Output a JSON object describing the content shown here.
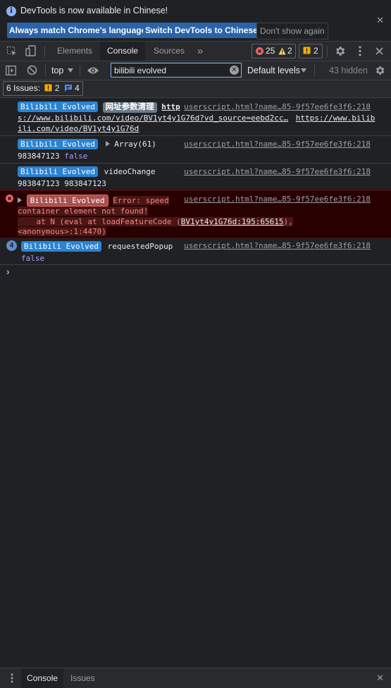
{
  "infobar": {
    "message": "DevTools is now available in Chinese!",
    "btn_match": "Always match Chrome's language",
    "btn_switch": "Switch DevTools to Chinese",
    "btn_dismiss": "Don't show again",
    "close": "✕"
  },
  "tabs": {
    "elements": "Elements",
    "console": "Console",
    "sources": "Sources",
    "more": "»"
  },
  "counts": {
    "errors": "25",
    "warnings": "2",
    "issues": "2"
  },
  "filter": {
    "context": "top",
    "search_value": "bilibili evolved",
    "levels": "Default levels",
    "hidden": "43 hidden"
  },
  "issues_bar": {
    "label": "6 Issues:",
    "warn_count": "2",
    "info_count": "4"
  },
  "messages": [
    {
      "badge": "Bilibili Evolved",
      "badge2": "网址参数清理",
      "text_a": "http",
      "text_b": "s://www.bilibili.com/video/BV1yt4y1G76d?vd_source=eebd2cc…",
      "text_c": "https://www.bilib",
      "text_d": "ili.com/video/BV1yt4y1G76d",
      "source": "userscript.html?name…85-9f57ee6fe3f6:218"
    },
    {
      "badge": "Bilibili Evolved",
      "text_a": "Array(61)",
      "num": "983847123",
      "kw": "false",
      "source": "userscript.html?name…85-9f57ee6fe3f6:218"
    },
    {
      "badge": "Bilibili Evolved",
      "text_a": "videoChange",
      "line2": "983847123 983847123",
      "source": "userscript.html?name…85-9f57ee6fe3f6:218"
    },
    {
      "badge": "Bilibili Evolved",
      "err_a": "Error: speed",
      "err_b": "container element not found!",
      "err_c_pre": "    at N (eval at loadFeatureCode (",
      "err_c_link": "BV1yt4y1G76d:195:65615",
      "err_c_post": "),",
      "err_d": "<anonymous>:1:4470)",
      "source": "userscript.html?name…85-9f57ee6fe3f6:218"
    },
    {
      "count": "4",
      "badge": "Bilibili Evolved",
      "text_a": "requestedPopup",
      "kw": "false",
      "source": "userscript.html?name…85-9f57ee6fe3f6:218"
    }
  ],
  "prompt": "›",
  "drawer": {
    "console": "Console",
    "issues": "Issues",
    "close": "✕"
  },
  "colors": {
    "accent": "#8ab4f8",
    "badge_blue": "#2a83d3",
    "error": "#f28b82",
    "button_blue": "#2a63a8"
  }
}
